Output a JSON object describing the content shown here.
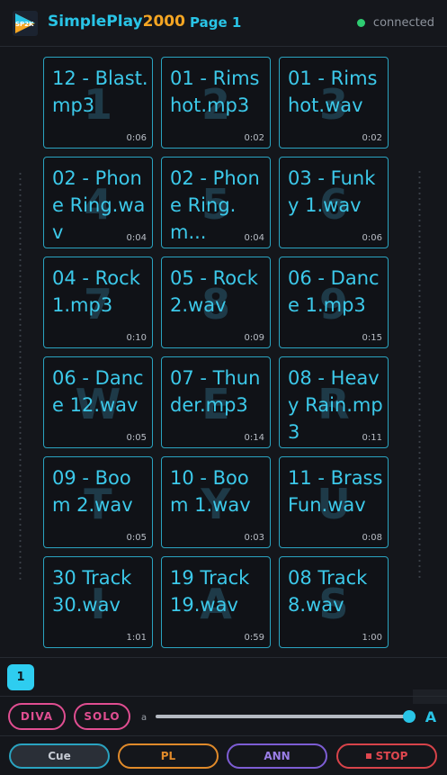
{
  "header": {
    "app_title_main": "SimplePlay",
    "app_title_accent": "2000",
    "logo_text": "SP2K",
    "page_label": "Page 1",
    "status_text": "connected",
    "status_color": "#2ecc71"
  },
  "pads": [
    {
      "name": "12 - Blast.mp3",
      "key": "1",
      "duration": "0:06"
    },
    {
      "name": "01 - Rimshot.mp3",
      "key": "2",
      "duration": "0:02"
    },
    {
      "name": "01 - Rimshot.wav",
      "key": "3",
      "duration": "0:02"
    },
    {
      "name": "02 - Phone Ring.wav",
      "key": "4",
      "duration": "0:04"
    },
    {
      "name": "02 - Phone Ring.m...",
      "key": "5",
      "duration": "0:04"
    },
    {
      "name": "03 - Funky 1.wav",
      "key": "6",
      "duration": "0:06"
    },
    {
      "name": "04 - Rock 1.mp3",
      "key": "7",
      "duration": "0:10"
    },
    {
      "name": "05 - Rock 2.wav",
      "key": "8",
      "duration": "0:09"
    },
    {
      "name": "06 - Dance 1.mp3",
      "key": "9",
      "duration": "0:15"
    },
    {
      "name": "06 - Dance 12.wav",
      "key": "W",
      "duration": "0:05"
    },
    {
      "name": "07 - Thunder.mp3",
      "key": "E",
      "duration": "0:14"
    },
    {
      "name": "08 - Heavy Rain.mp3",
      "key": "R",
      "duration": "0:11"
    },
    {
      "name": "09 - Boom 2.wav",
      "key": "T",
      "duration": "0:05"
    },
    {
      "name": "10 - Boom 1.wav",
      "key": "Y",
      "duration": "0:03"
    },
    {
      "name": "11 - Brass Fun.wav",
      "key": "U",
      "duration": "0:08"
    },
    {
      "name": "30 Track 30.wav",
      "key": "I",
      "duration": "1:01"
    },
    {
      "name": "19 Track 19.wav",
      "key": "A",
      "duration": "0:59"
    },
    {
      "name": "08 Track 8.wav",
      "key": "S",
      "duration": "1:00"
    }
  ],
  "pages": {
    "current": "1"
  },
  "controls": {
    "diva_label": "DIVA",
    "solo_label": "SOLO",
    "slider_min_label": "a",
    "slider_max_label": "A",
    "slider_value": 1.0
  },
  "bottom_bar": {
    "cue_label": "Cue",
    "pl_label": "PL",
    "ann_label": "ANN",
    "stop_label": "STOP"
  },
  "colors": {
    "accent": "#29c4e6",
    "brand_accent": "#f5a623",
    "pad_border": "#2aa3c0",
    "pill": "#e04e91",
    "pl": "#e08a2a",
    "ann": "#7d5dd4",
    "stop": "#d8434a"
  }
}
